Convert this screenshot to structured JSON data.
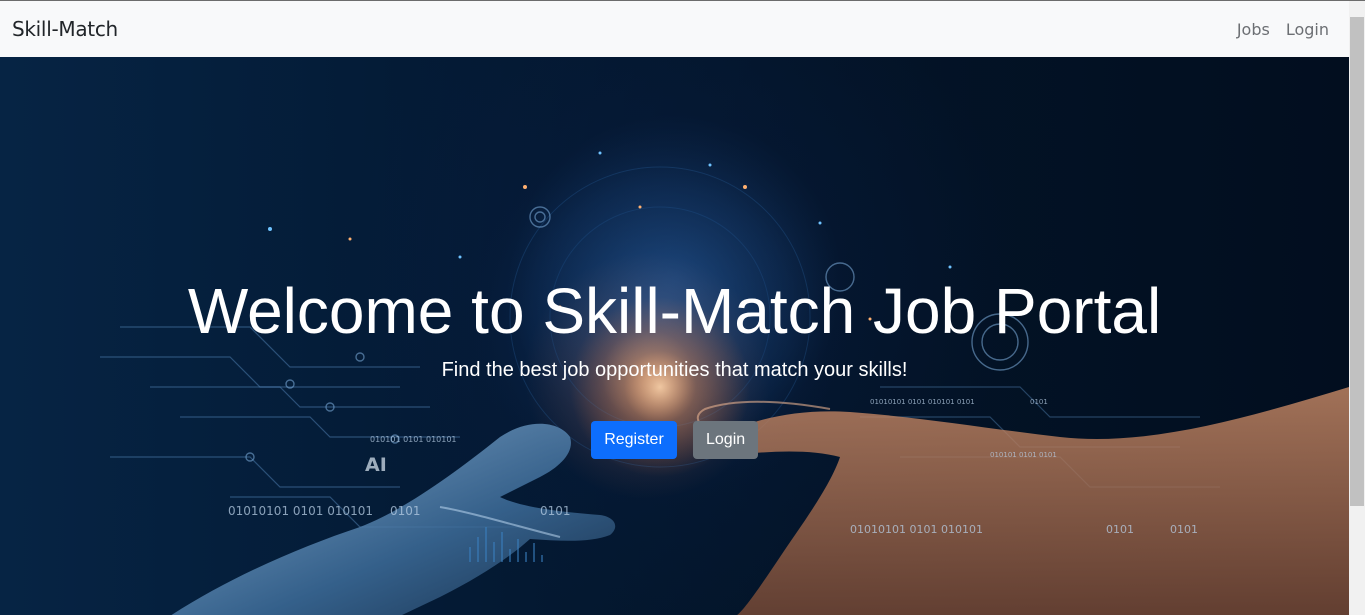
{
  "navbar": {
    "brand": "Skill-Match",
    "links": [
      "Jobs",
      "Login"
    ]
  },
  "hero": {
    "title": "Welcome to Skill-Match Job Portal",
    "subtitle": "Find the best job opportunities that match your skills!",
    "register_label": "Register",
    "login_label": "Login",
    "bg_text": {
      "ai": "AI",
      "bin1": "01010101 0101 010101",
      "bin2": "0101",
      "bin3": "0101",
      "bin4": "01010101 0101 010101",
      "bin5": "0101",
      "bin6": "0101",
      "bin7": "010101 0101 010101",
      "bin8": "01010101 0101 010101 0101",
      "bin9": "0101",
      "bin10": "010101 0101 0101"
    }
  },
  "colors": {
    "primary": "#0d6efd",
    "secondary": "#6c757d",
    "navbar_bg": "#f8f9fa"
  }
}
